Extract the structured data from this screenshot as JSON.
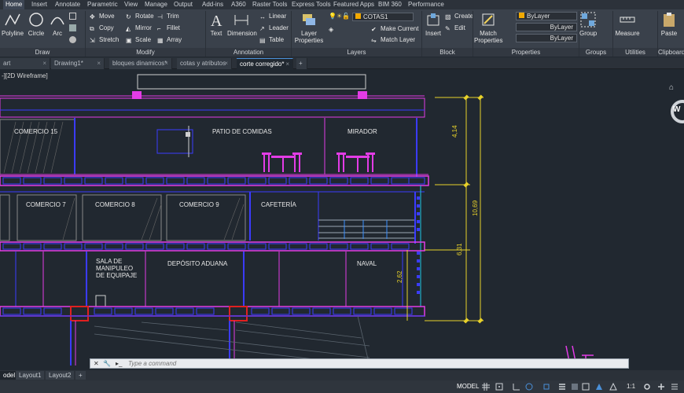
{
  "ribbon_tabs": [
    "Home",
    "Insert",
    "Annotate",
    "Parametric",
    "View",
    "Manage",
    "Output",
    "Add-ins",
    "A360",
    "Raster Tools",
    "Express Tools",
    "Featured Apps",
    "BIM 360",
    "Performance"
  ],
  "draw": {
    "polyline": "Polyline",
    "circle": "Circle",
    "arc": "Arc",
    "label": "Draw"
  },
  "modify": {
    "move": "Move",
    "rotate": "Rotate",
    "trim": "Trim",
    "copy": "Copy",
    "mirror": "Mirror",
    "fillet": "Fillet",
    "stretch": "Stretch",
    "scale": "Scale",
    "array": "Array",
    "label": "Modify"
  },
  "annotation": {
    "text": "Text",
    "dimension": "Dimension",
    "linear": "Linear",
    "leader": "Leader",
    "table": "Table",
    "label": "Annotation"
  },
  "layers": {
    "properties": "Layer Properties",
    "current_layer": "COTAS1",
    "make_current": "Make Current",
    "match_layer": "Match Layer",
    "label": "Layers"
  },
  "block": {
    "insert": "Insert",
    "create": "Create",
    "edit": "Edit",
    "label": "Block"
  },
  "properties": {
    "match": "Match Properties",
    "color": "ByLayer",
    "linetype": "ByLayer",
    "lineweight": "ByLayer",
    "label": "Properties"
  },
  "groups": {
    "group": "Group",
    "label": "Groups"
  },
  "utilities": {
    "measure": "Measure",
    "label": "Utilities"
  },
  "clipboard": {
    "paste": "Paste",
    "label": "Clipboard"
  },
  "file_tabs": [
    "art",
    "Drawing1*",
    "bloques dinamicos*",
    "cotas y atributos",
    "corte corregido*"
  ],
  "viewport_label": "-][2D Wireframe]",
  "drawing": {
    "rooms": [
      "COMERCIO 15",
      "PATIO DE COMIDAS",
      "MIRADOR",
      "COMERCIO 7",
      "COMERCIO 8",
      "COMERCIO 9",
      "CAFETERÍA",
      "SALA DE",
      "MANIPULEO",
      "DE EQUIPAJE",
      "DEPÓSITO ADUANA",
      "NAVAL"
    ],
    "dimensions": [
      "4,14",
      "10,69",
      "6,31",
      "2,62"
    ],
    "compass": "W"
  },
  "command": {
    "placeholder": "Type a command"
  },
  "layout_tabs": [
    "odel",
    "Layout1",
    "Layout2"
  ],
  "status": {
    "model": "MODEL",
    "scale": "1:1"
  },
  "colors": {
    "accent": "#4a90d9",
    "magenta": "#e33ce6",
    "blue": "#3b3bff",
    "yellow": "#e8d22a",
    "red": "#e02020"
  }
}
